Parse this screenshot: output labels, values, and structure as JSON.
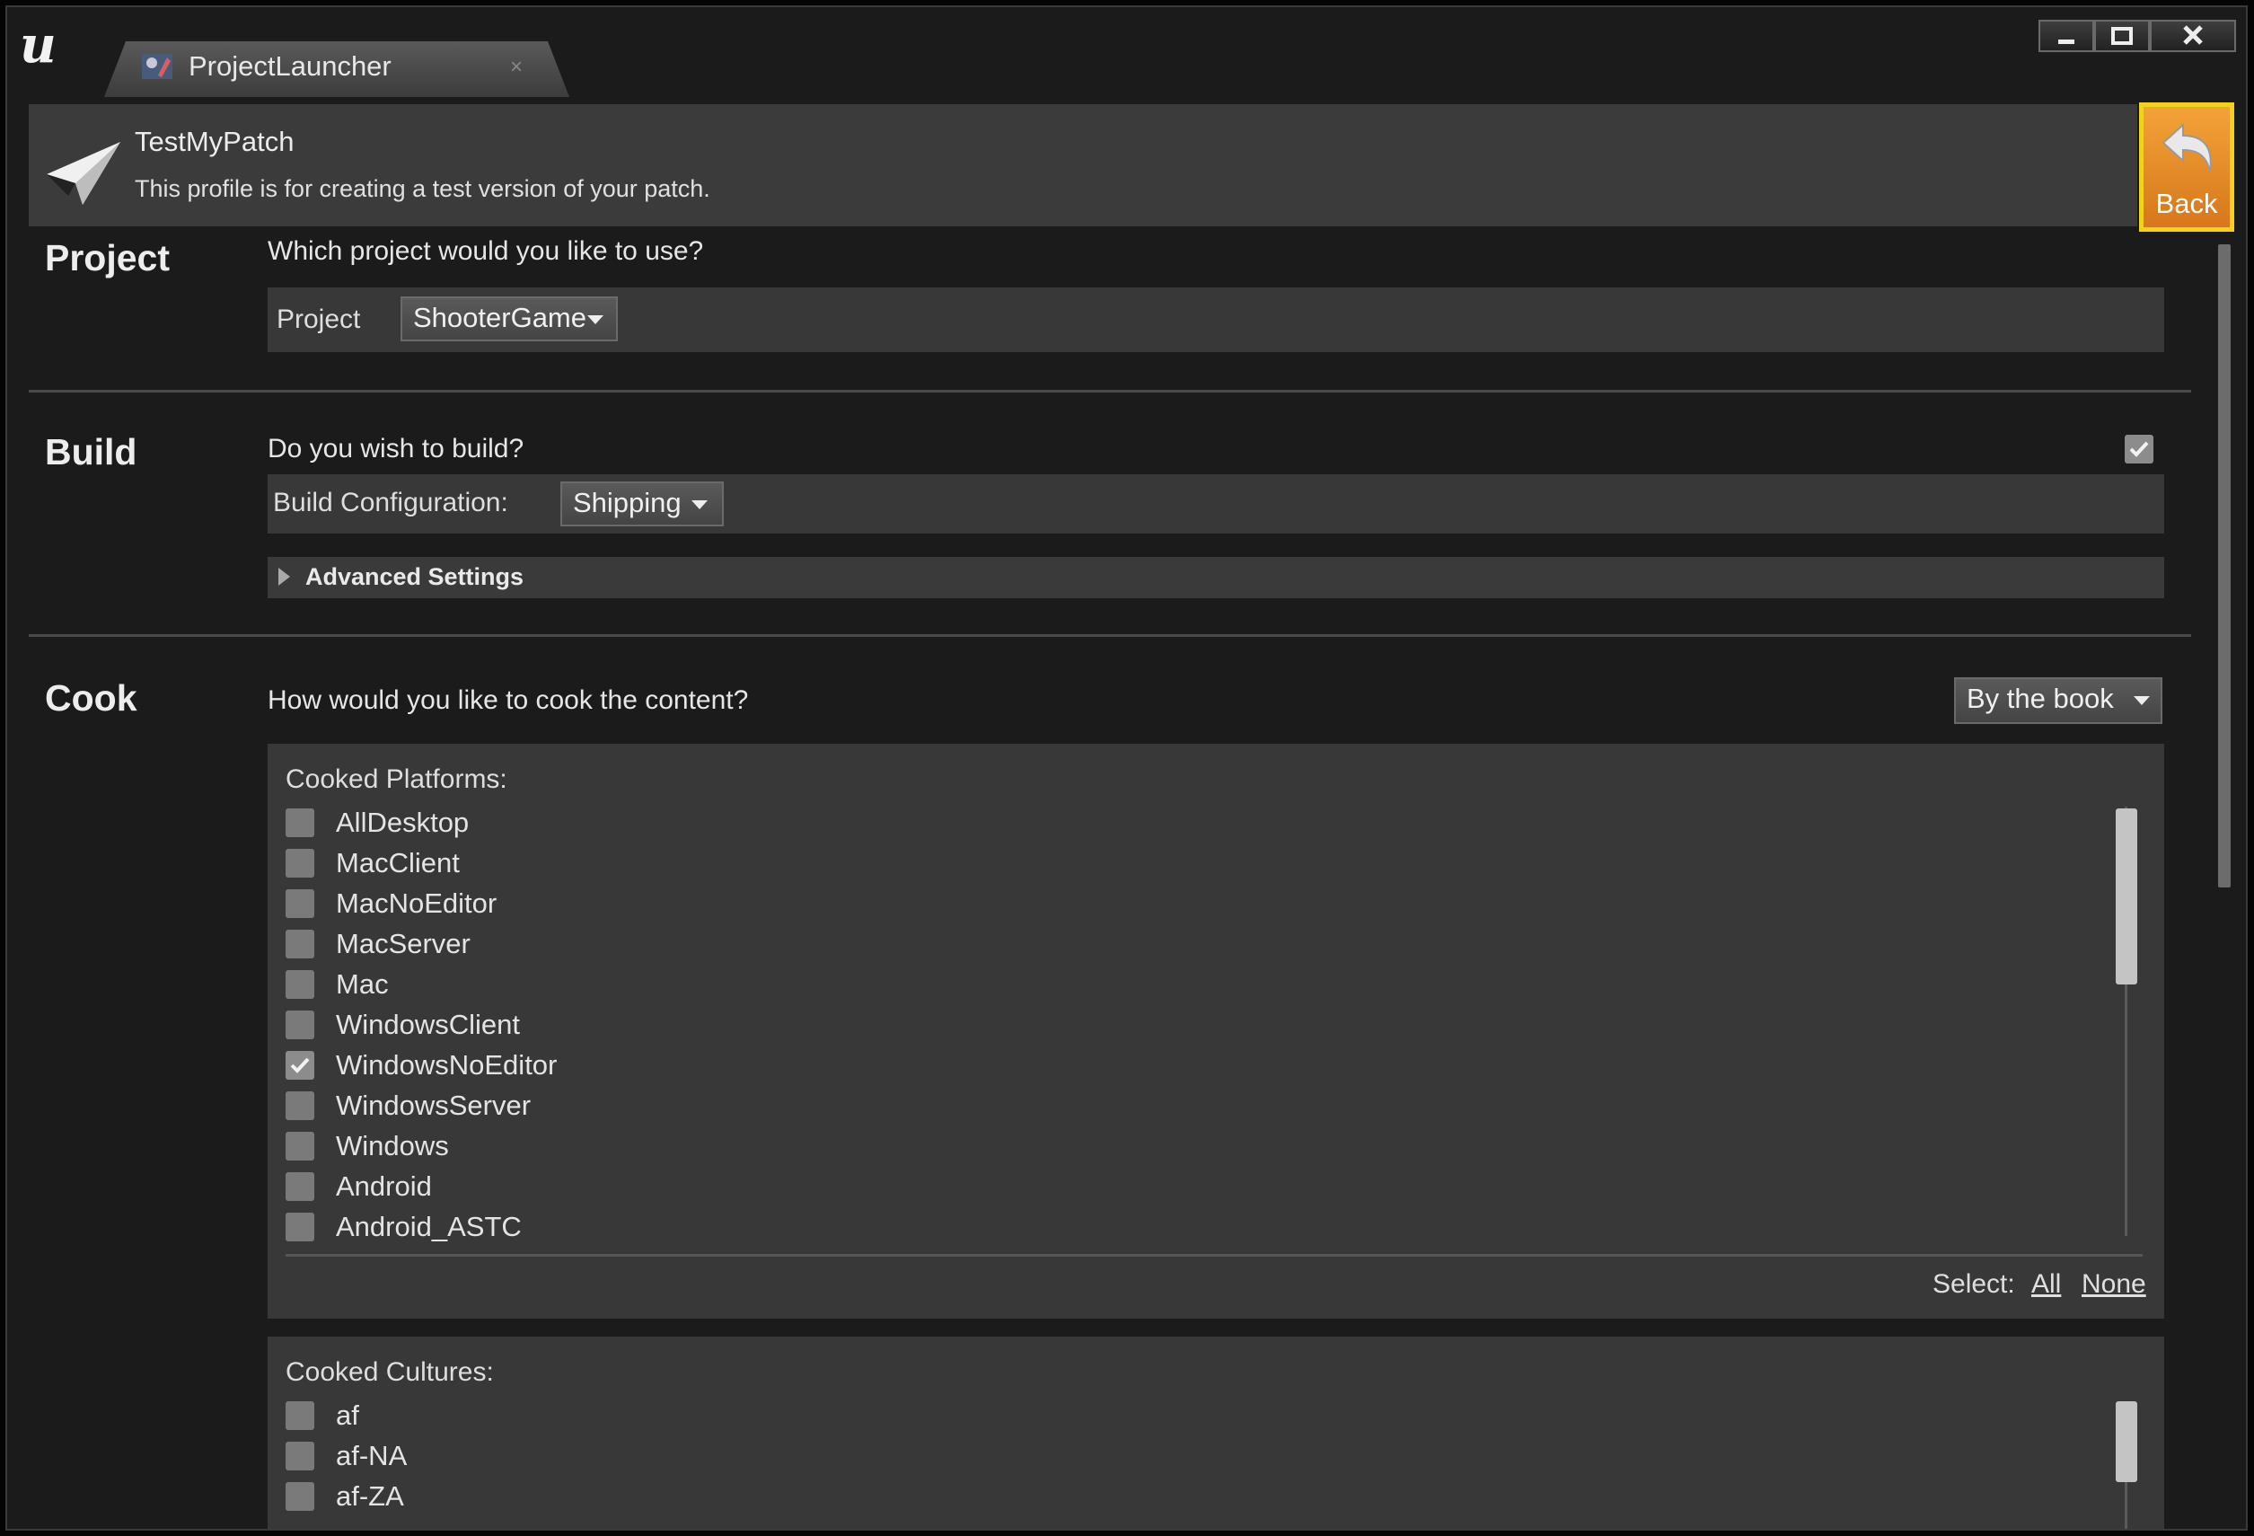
{
  "window": {
    "tab_title": "ProjectLauncher",
    "tab_close": "×",
    "minimize_glyph": "▁",
    "close_glyph": "✕"
  },
  "profile": {
    "name": "TestMyPatch",
    "description": "This profile is for creating a test version of your patch.",
    "back_label": "Back"
  },
  "project": {
    "section_title": "Project",
    "question": "Which project would you like to use?",
    "field_label": "Project",
    "selected": "ShooterGame"
  },
  "build": {
    "section_title": "Build",
    "question": "Do you wish to build?",
    "enabled": true,
    "config_label": "Build Configuration:",
    "config_selected": "Shipping",
    "advanced_label": "Advanced Settings"
  },
  "cook": {
    "section_title": "Cook",
    "question": "How would you like to cook the content?",
    "mode_selected": "By the book",
    "platforms_label": "Cooked Platforms:",
    "platforms": [
      {
        "name": "AllDesktop",
        "checked": false
      },
      {
        "name": "MacClient",
        "checked": false
      },
      {
        "name": "MacNoEditor",
        "checked": false
      },
      {
        "name": "MacServer",
        "checked": false
      },
      {
        "name": "Mac",
        "checked": false
      },
      {
        "name": "WindowsClient",
        "checked": false
      },
      {
        "name": "WindowsNoEditor",
        "checked": true
      },
      {
        "name": "WindowsServer",
        "checked": false
      },
      {
        "name": "Windows",
        "checked": false
      },
      {
        "name": "Android",
        "checked": false
      },
      {
        "name": "Android_ASTC",
        "checked": false
      }
    ],
    "select_label": "Select:",
    "select_all": "All",
    "select_none": "None",
    "cultures_label": "Cooked Cultures:",
    "cultures": [
      {
        "name": "af",
        "checked": false
      },
      {
        "name": "af-NA",
        "checked": false
      },
      {
        "name": "af-ZA",
        "checked": false
      }
    ]
  },
  "colors": {
    "window_bg": "#1b1b1b",
    "panel_bg": "#383838",
    "header_bg": "#3b3b3b",
    "back_button": "#e8902a",
    "back_border": "#f3d21c",
    "text": "#e6e6e6"
  }
}
